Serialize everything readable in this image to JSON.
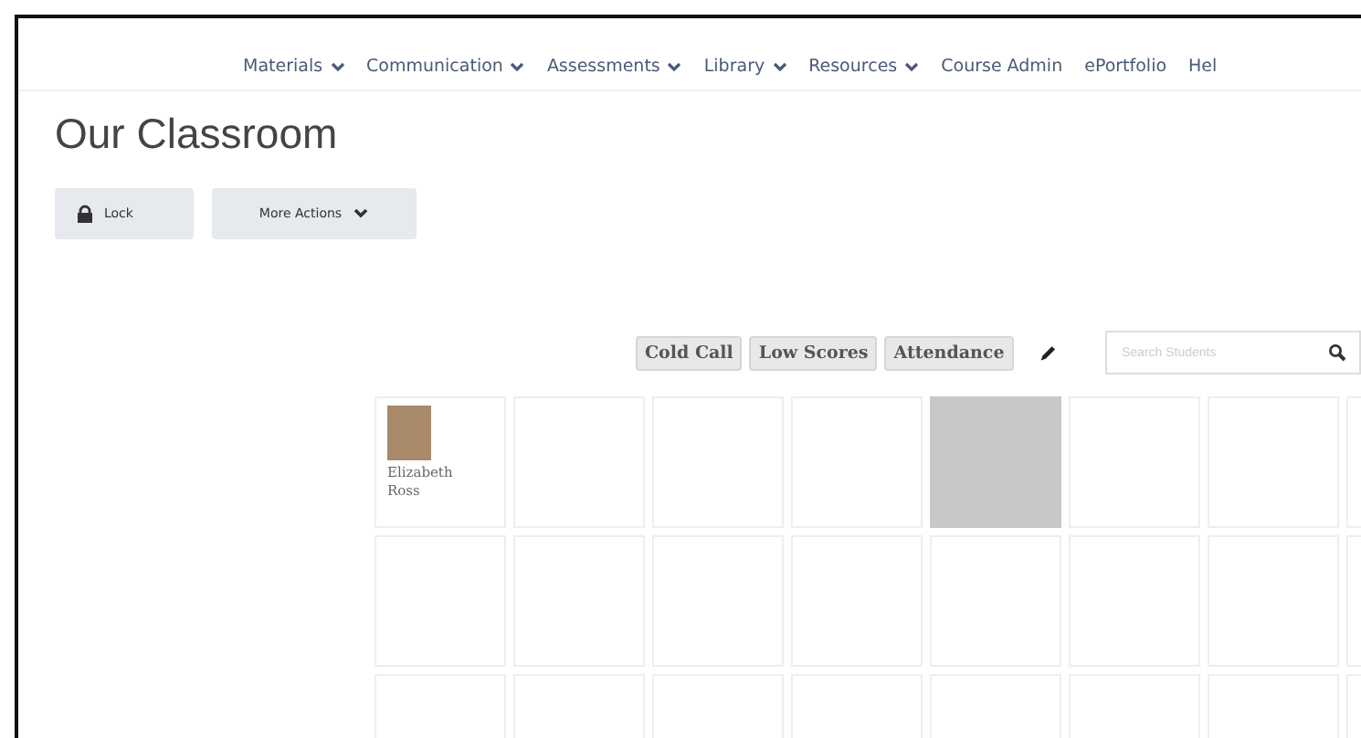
{
  "nav": [
    {
      "label": "Materials",
      "dropdown": true
    },
    {
      "label": "Communication",
      "dropdown": true
    },
    {
      "label": "Assessments",
      "dropdown": true
    },
    {
      "label": "Library",
      "dropdown": true
    },
    {
      "label": "Resources",
      "dropdown": true
    },
    {
      "label": "Course Admin",
      "dropdown": false
    },
    {
      "label": "ePortfolio",
      "dropdown": false
    },
    {
      "label": "Hel",
      "dropdown": false
    }
  ],
  "page_title": "Our Classroom",
  "actions": [
    {
      "label": "Lock",
      "kind": "lock"
    },
    {
      "label": "More Actions",
      "kind": "menu"
    }
  ],
  "toolbar": {
    "buttons": [
      "Cold Call",
      "Low Scores",
      "Attendance"
    ],
    "search": {
      "placeholder": "Search Students"
    }
  },
  "seats": [
    [
      {
        "kind": "student",
        "name": "Elizabeth Ross"
      },
      {
        "kind": "empty"
      },
      {
        "kind": "empty"
      },
      {
        "kind": "empty"
      },
      {
        "kind": "blocked"
      },
      {
        "kind": "empty"
      },
      {
        "kind": "empty"
      },
      {
        "kind": "empty"
      }
    ],
    [
      {
        "kind": "empty"
      },
      {
        "kind": "empty"
      },
      {
        "kind": "empty"
      },
      {
        "kind": "empty"
      },
      {
        "kind": "empty"
      },
      {
        "kind": "empty"
      },
      {
        "kind": "empty"
      },
      {
        "kind": "empty"
      }
    ],
    [
      {
        "kind": "empty"
      },
      {
        "kind": "empty"
      },
      {
        "kind": "empty"
      },
      {
        "kind": "empty"
      },
      {
        "kind": "empty"
      },
      {
        "kind": "empty"
      },
      {
        "kind": "empty"
      },
      {
        "kind": "empty"
      }
    ]
  ]
}
